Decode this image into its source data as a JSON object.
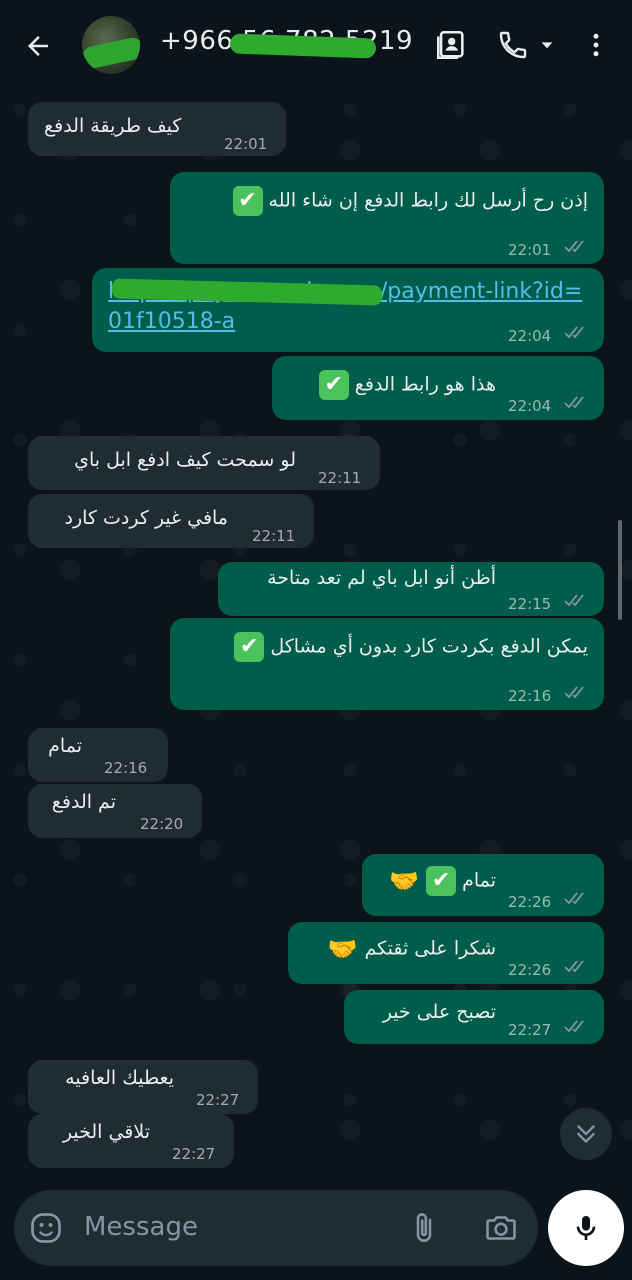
{
  "header": {
    "contact_name": "+966 56 782 5219",
    "back_icon": "arrow-left-icon",
    "contacts_icon": "contact-card-icon",
    "call_icon": "phone-icon",
    "menu_icon": "more-vert-icon"
  },
  "messages": [
    {
      "dir": "in",
      "text": "كيف طريقة الدفع",
      "time": "22:01"
    },
    {
      "dir": "out",
      "text": "إذن رح أرسل لك رابط الدفع إن شاء الله",
      "time": "22:01",
      "emoji": "✔"
    },
    {
      "dir": "out",
      "link_line1": "https://pay.example.com/payment-link?id=",
      "link_line2": "01f10518-a",
      "time": "22:04"
    },
    {
      "dir": "out",
      "text": "هذا هو رابط الدفع",
      "time": "22:04",
      "emoji": "✔"
    },
    {
      "dir": "in",
      "text": "لو سمحت كيف ادفع ابل باي",
      "time": "22:11"
    },
    {
      "dir": "in",
      "text": "مافي غير كردت كارد",
      "time": "22:11"
    },
    {
      "dir": "out",
      "text": "أظن أنو ابل باي لم تعد متاحة",
      "time": "22:15"
    },
    {
      "dir": "out",
      "text": "يمكن الدفع بكردت كارد بدون أي مشاكل",
      "time": "22:16",
      "emoji": "✔"
    },
    {
      "dir": "in",
      "text": "تمام",
      "time": "22:16"
    },
    {
      "dir": "in",
      "text": "تم الدفع",
      "time": "22:20"
    },
    {
      "dir": "out",
      "text": "تمام",
      "time": "22:26",
      "emoji": "✔",
      "emoji2": "🤝"
    },
    {
      "dir": "out",
      "text": "شكرا على ثقتكم",
      "time": "22:26",
      "emoji2": "🤝"
    },
    {
      "dir": "out",
      "text": "تصبح على خير",
      "time": "22:27"
    },
    {
      "dir": "in",
      "text": "يعطيك العافيه",
      "time": "22:27"
    },
    {
      "dir": "in",
      "text": "تلاقي الخير",
      "time": "22:27"
    }
  ],
  "composer": {
    "placeholder": "Message",
    "emoji_icon": "emoji-icon",
    "attach_icon": "paperclip-icon",
    "camera_icon": "camera-icon",
    "mic_icon": "microphone-icon"
  },
  "colors": {
    "background": "#0b141a",
    "incoming_bubble": "#202c33",
    "outgoing_bubble": "#005c4b",
    "link": "#53bdeb",
    "ticks": "#8696a0"
  }
}
